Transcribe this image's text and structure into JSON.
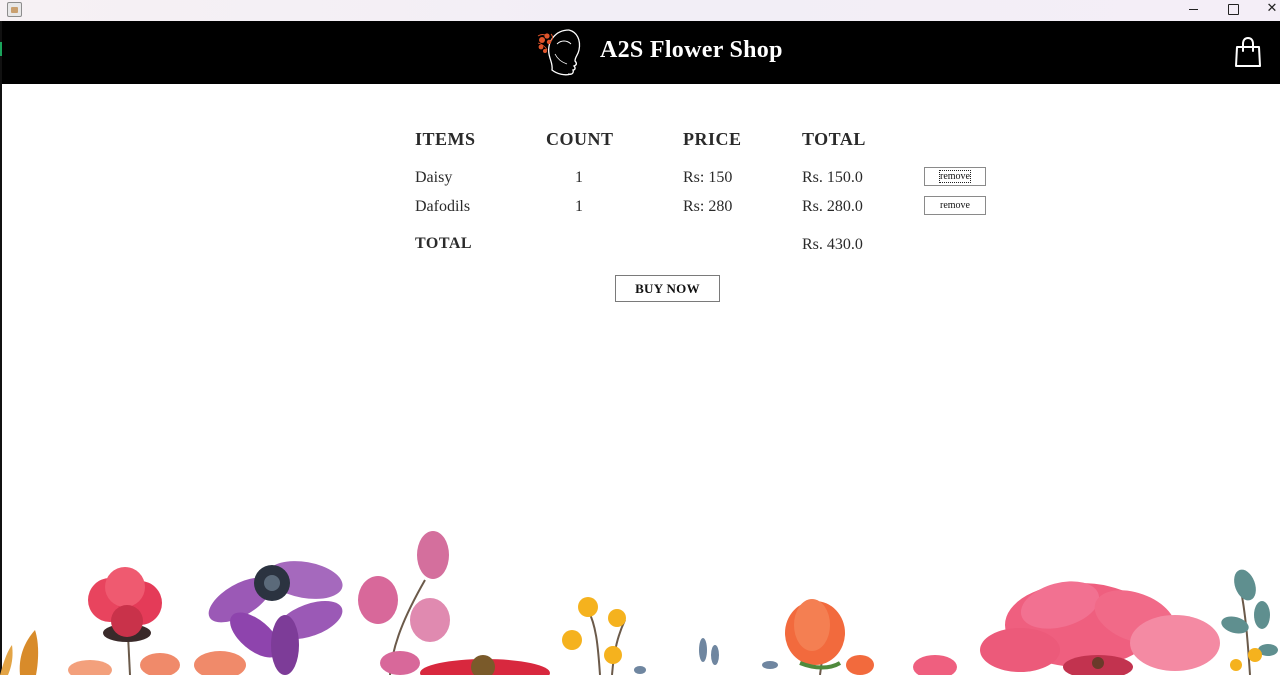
{
  "window": {
    "title": "",
    "controls": [
      "minimize-icon",
      "maximize-icon",
      "close-icon"
    ]
  },
  "header": {
    "title": "A2S Flower Shop",
    "logo_icon": "woman-profile-with-flowers-logo",
    "cart_icon": "shopping-bag-icon",
    "background": "#000000",
    "accent": "#e0542a"
  },
  "cart": {
    "columns": [
      "ITEMS",
      "COUNT",
      "PRICE",
      "TOTAL"
    ],
    "rows": [
      {
        "item": "Daisy",
        "count": "1",
        "price": "Rs: 150",
        "total": "Rs. 150.0",
        "remove_label": "remove"
      },
      {
        "item": "Dafodils",
        "count": "1",
        "price": "Rs: 280",
        "total": "Rs. 280.0",
        "remove_label": "remove"
      }
    ],
    "total_label": "TOTAL",
    "grand_total": "Rs. 430.0",
    "buy_label": "BUY NOW"
  },
  "decoration": {
    "icon": "watercolor-flowers-border",
    "colors": [
      "#e8445e",
      "#9b59b6",
      "#f5b21e",
      "#f26a3d",
      "#ef5f7f",
      "#5f8f8f"
    ]
  }
}
